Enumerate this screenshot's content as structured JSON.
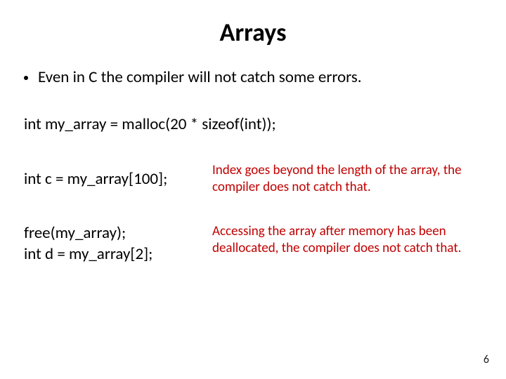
{
  "title": "Arrays",
  "bullet": "Even in C the compiler will not catch some errors.",
  "code1": "int my_array = malloc(20 * sizeof(int));",
  "pair1": {
    "code": "int c = my_array[100];",
    "note": "Index goes beyond the length of the array, the compiler does not catch that."
  },
  "pair2": {
    "code_a": "free(my_array);",
    "code_b": "int d = my_array[2];",
    "note": "Accessing the array after memory has been deallocated, the compiler does not catch that."
  },
  "page": "6"
}
